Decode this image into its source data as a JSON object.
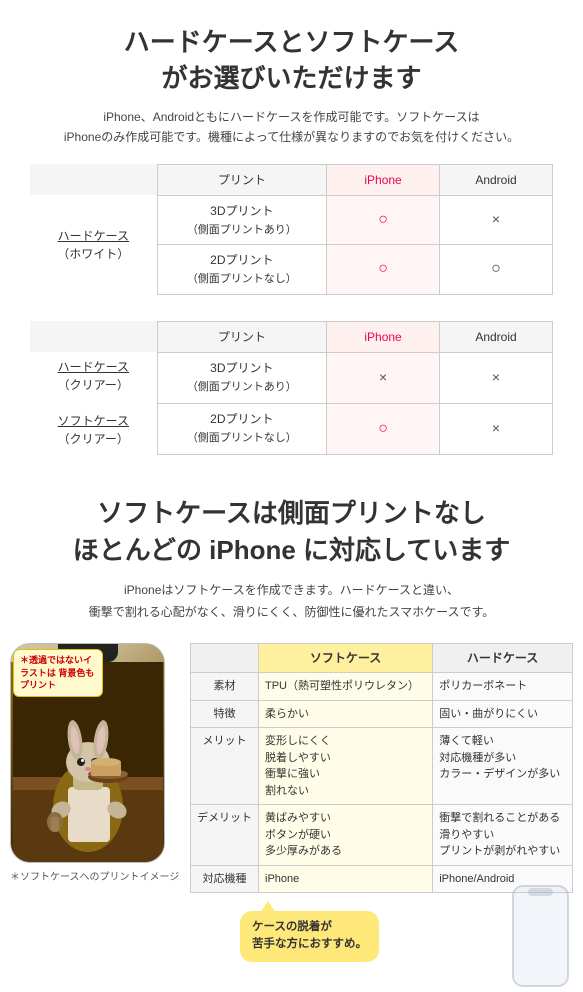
{
  "top": {
    "title_line1": "ハードケースとソフトケース",
    "title_line2": "がお選びいただけます",
    "subtitle": "iPhone、Androidともにハードケースを作成可能です。ソフトケースは\niPhoneのみ作成可能です。機種によって仕様が異なりますのでお気を付けください。"
  },
  "table1": {
    "col_headers": [
      "プリント",
      "iPhone",
      "Android"
    ],
    "left_labels": [
      {
        "label": "ハードケース",
        "sub": "（ホワイト）"
      },
      "",
      ""
    ],
    "rows": [
      {
        "print": "3Dプリント\n（側面プリントあり）",
        "iphone": "○",
        "android": "×"
      },
      {
        "print": "2Dプリント\n（側面プリントなし）",
        "iphone": "○",
        "android": "○"
      }
    ]
  },
  "table2": {
    "col_headers": [
      "プリント",
      "iPhone",
      "Android"
    ],
    "left_labels": [
      {
        "label": "ハードケース",
        "sub": "（クリアー）"
      },
      {
        "label": "ソフトケース",
        "sub": "（クリアー）"
      }
    ],
    "rows": [
      {
        "print": "3Dプリント\n（側面プリントあり）",
        "iphone": "×",
        "android": "×"
      },
      {
        "print": "2Dプリント\n（側面プリントなし）",
        "iphone": "○",
        "android": "×"
      }
    ]
  },
  "second_section": {
    "title_line1": "ソフトケースは側面プリントなし",
    "title_line2": "ほとんどの iPhone に対応しています",
    "subtitle": "iPhoneはソフトケースを作成できます。ハードケースと違い、\n衝撃で割れる心配がなく、滑りにくく、防御性に優れたスマホケースです。"
  },
  "annotation": {
    "text": "＊透過ではないイラストは\n背景色もプリント"
  },
  "compare": {
    "headers": {
      "soft": "ソフトケース",
      "hard": "ハードケース"
    },
    "rows": [
      {
        "label": "素材",
        "soft": "TPU（熱可塑性ポリウレタン）",
        "hard": "ポリカーボネート"
      },
      {
        "label": "特徴",
        "soft": "柔らかい",
        "hard": "固い・曲がりにくい"
      },
      {
        "label": "メリット",
        "soft": "変形しにくく\n脱着しやすい\n衝撃に強い\n割れない",
        "hard": "薄くて軽い\n対応機種が多い\nカラー・デザインが多い"
      },
      {
        "label": "デメリット",
        "soft": "黄ばみやすい\nボタンが硬い\n多少厚みがある",
        "hard": "衝撃で割れることがある\n滑りやすい\nプリントが剥がれやすい"
      },
      {
        "label": "対応機種",
        "soft": "iPhone",
        "hard": "iPhone/Android"
      }
    ]
  },
  "speech_bubble": {
    "line1": "ケースの脱着が",
    "line2": "苦手な方におすすめ。"
  },
  "bottom_label": "＊ソフトケースへのプリントイメージ"
}
